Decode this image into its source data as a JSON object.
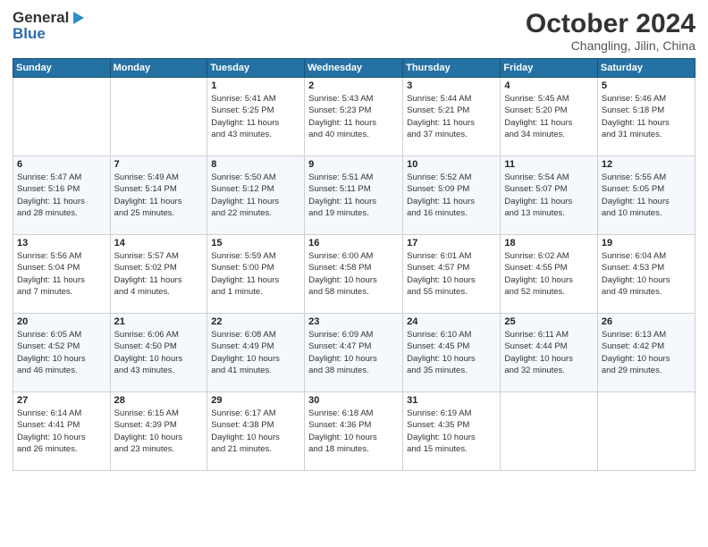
{
  "header": {
    "logo_general": "General",
    "logo_blue": "Blue",
    "title": "October 2024",
    "subtitle": "Changling, Jilin, China"
  },
  "columns": [
    "Sunday",
    "Monday",
    "Tuesday",
    "Wednesday",
    "Thursday",
    "Friday",
    "Saturday"
  ],
  "weeks": [
    [
      {
        "day": "",
        "info": ""
      },
      {
        "day": "",
        "info": ""
      },
      {
        "day": "1",
        "info": "Sunrise: 5:41 AM\nSunset: 5:25 PM\nDaylight: 11 hours\nand 43 minutes."
      },
      {
        "day": "2",
        "info": "Sunrise: 5:43 AM\nSunset: 5:23 PM\nDaylight: 11 hours\nand 40 minutes."
      },
      {
        "day": "3",
        "info": "Sunrise: 5:44 AM\nSunset: 5:21 PM\nDaylight: 11 hours\nand 37 minutes."
      },
      {
        "day": "4",
        "info": "Sunrise: 5:45 AM\nSunset: 5:20 PM\nDaylight: 11 hours\nand 34 minutes."
      },
      {
        "day": "5",
        "info": "Sunrise: 5:46 AM\nSunset: 5:18 PM\nDaylight: 11 hours\nand 31 minutes."
      }
    ],
    [
      {
        "day": "6",
        "info": "Sunrise: 5:47 AM\nSunset: 5:16 PM\nDaylight: 11 hours\nand 28 minutes."
      },
      {
        "day": "7",
        "info": "Sunrise: 5:49 AM\nSunset: 5:14 PM\nDaylight: 11 hours\nand 25 minutes."
      },
      {
        "day": "8",
        "info": "Sunrise: 5:50 AM\nSunset: 5:12 PM\nDaylight: 11 hours\nand 22 minutes."
      },
      {
        "day": "9",
        "info": "Sunrise: 5:51 AM\nSunset: 5:11 PM\nDaylight: 11 hours\nand 19 minutes."
      },
      {
        "day": "10",
        "info": "Sunrise: 5:52 AM\nSunset: 5:09 PM\nDaylight: 11 hours\nand 16 minutes."
      },
      {
        "day": "11",
        "info": "Sunrise: 5:54 AM\nSunset: 5:07 PM\nDaylight: 11 hours\nand 13 minutes."
      },
      {
        "day": "12",
        "info": "Sunrise: 5:55 AM\nSunset: 5:05 PM\nDaylight: 11 hours\nand 10 minutes."
      }
    ],
    [
      {
        "day": "13",
        "info": "Sunrise: 5:56 AM\nSunset: 5:04 PM\nDaylight: 11 hours\nand 7 minutes."
      },
      {
        "day": "14",
        "info": "Sunrise: 5:57 AM\nSunset: 5:02 PM\nDaylight: 11 hours\nand 4 minutes."
      },
      {
        "day": "15",
        "info": "Sunrise: 5:59 AM\nSunset: 5:00 PM\nDaylight: 11 hours\nand 1 minute."
      },
      {
        "day": "16",
        "info": "Sunrise: 6:00 AM\nSunset: 4:58 PM\nDaylight: 10 hours\nand 58 minutes."
      },
      {
        "day": "17",
        "info": "Sunrise: 6:01 AM\nSunset: 4:57 PM\nDaylight: 10 hours\nand 55 minutes."
      },
      {
        "day": "18",
        "info": "Sunrise: 6:02 AM\nSunset: 4:55 PM\nDaylight: 10 hours\nand 52 minutes."
      },
      {
        "day": "19",
        "info": "Sunrise: 6:04 AM\nSunset: 4:53 PM\nDaylight: 10 hours\nand 49 minutes."
      }
    ],
    [
      {
        "day": "20",
        "info": "Sunrise: 6:05 AM\nSunset: 4:52 PM\nDaylight: 10 hours\nand 46 minutes."
      },
      {
        "day": "21",
        "info": "Sunrise: 6:06 AM\nSunset: 4:50 PM\nDaylight: 10 hours\nand 43 minutes."
      },
      {
        "day": "22",
        "info": "Sunrise: 6:08 AM\nSunset: 4:49 PM\nDaylight: 10 hours\nand 41 minutes."
      },
      {
        "day": "23",
        "info": "Sunrise: 6:09 AM\nSunset: 4:47 PM\nDaylight: 10 hours\nand 38 minutes."
      },
      {
        "day": "24",
        "info": "Sunrise: 6:10 AM\nSunset: 4:45 PM\nDaylight: 10 hours\nand 35 minutes."
      },
      {
        "day": "25",
        "info": "Sunrise: 6:11 AM\nSunset: 4:44 PM\nDaylight: 10 hours\nand 32 minutes."
      },
      {
        "day": "26",
        "info": "Sunrise: 6:13 AM\nSunset: 4:42 PM\nDaylight: 10 hours\nand 29 minutes."
      }
    ],
    [
      {
        "day": "27",
        "info": "Sunrise: 6:14 AM\nSunset: 4:41 PM\nDaylight: 10 hours\nand 26 minutes."
      },
      {
        "day": "28",
        "info": "Sunrise: 6:15 AM\nSunset: 4:39 PM\nDaylight: 10 hours\nand 23 minutes."
      },
      {
        "day": "29",
        "info": "Sunrise: 6:17 AM\nSunset: 4:38 PM\nDaylight: 10 hours\nand 21 minutes."
      },
      {
        "day": "30",
        "info": "Sunrise: 6:18 AM\nSunset: 4:36 PM\nDaylight: 10 hours\nand 18 minutes."
      },
      {
        "day": "31",
        "info": "Sunrise: 6:19 AM\nSunset: 4:35 PM\nDaylight: 10 hours\nand 15 minutes."
      },
      {
        "day": "",
        "info": ""
      },
      {
        "day": "",
        "info": ""
      }
    ]
  ]
}
